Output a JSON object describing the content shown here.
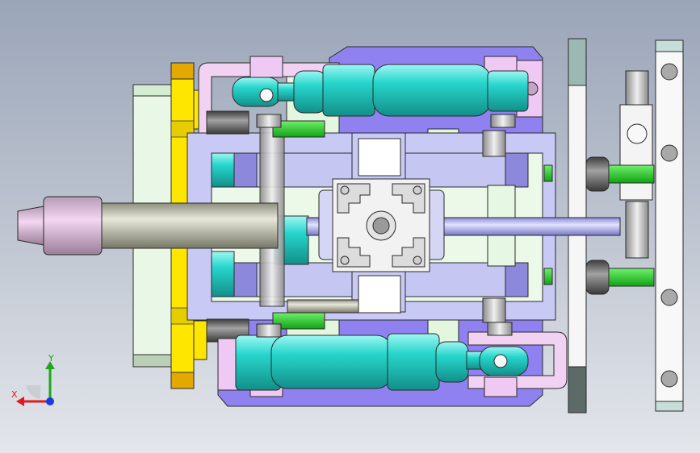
{
  "viewport": {
    "background_top": "#9aa5b8",
    "background_bottom": "#e3e6eb"
  },
  "colors": {
    "cylinder": "#27d6cc",
    "cylinder_dark": "#159a94",
    "lavender_plate": "#c8c8f6",
    "lavender_block": "#8f8ae0",
    "purple_base": "#8d7ff2",
    "yellow_plate": "#ffe600",
    "orange_plate": "#e0a800",
    "shaft": "#c9c9b6",
    "green_rod": "#22d427",
    "pink_part": "#f0c8f4",
    "mint_plate": "#dff6dc",
    "white_plate": "#f4f4f4"
  },
  "triad": {
    "x_label": "X",
    "y_label": "Y",
    "x_color": "#e01b1b",
    "y_color": "#1ea61e",
    "z_color": "#1b3ae0",
    "icon": "coordinate-triad-icon"
  }
}
